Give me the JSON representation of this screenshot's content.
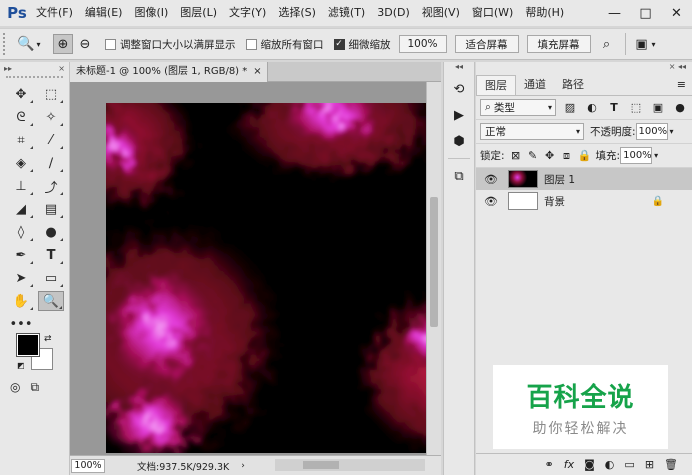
{
  "app": {
    "logo": "Ps"
  },
  "menu": [
    "文件(F)",
    "编辑(E)",
    "图像(I)",
    "图层(L)",
    "文字(Y)",
    "选择(S)",
    "滤镜(T)",
    "3D(D)",
    "视图(V)",
    "窗口(W)",
    "帮助(H)"
  ],
  "window_controls": {
    "minimize": "—",
    "maximize": "□",
    "close": "✕"
  },
  "options": {
    "resize_windows_label": "调整窗口大小以满屏显示",
    "resize_windows_checked": false,
    "zoom_all_label": "缩放所有窗口",
    "zoom_all_checked": false,
    "scrubby_zoom_label": "细微缩放",
    "scrubby_zoom_checked": true,
    "zoom_100_label": "100%",
    "fit_screen_label": "适合屏幕",
    "fill_screen_label": "填充屏幕"
  },
  "document": {
    "tab_title": "未标题-1 @ 100% (图层 1, RGB/8) *",
    "tab_close": "×",
    "zoom_value": "100%",
    "doc_info": "文档:937.5K/929.3K",
    "status_arrow": "›"
  },
  "layers_panel": {
    "tabs": [
      "图层",
      "通道",
      "路径"
    ],
    "active_tab": "图层",
    "filter_kind": "类型",
    "blend_mode": "正常",
    "opacity_label": "不透明度:",
    "opacity_value": "100%",
    "lock_label": "锁定:",
    "fill_label": "填充:",
    "fill_value": "100%",
    "layers": [
      {
        "name": "图层 1",
        "selected": true,
        "locked": false
      },
      {
        "name": "背景",
        "selected": false,
        "locked": true
      }
    ]
  },
  "watermark": {
    "title": "百科全说",
    "subtitle": "助你轻松解决"
  },
  "colors": {
    "foreground": "#000000",
    "background": "#ffffff",
    "ps_blue": "#1f4f9a",
    "watermark_green": "#16a34a"
  }
}
